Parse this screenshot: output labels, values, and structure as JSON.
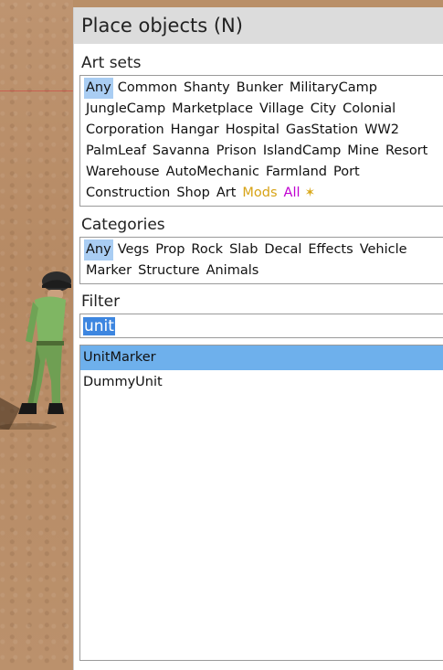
{
  "panel": {
    "title": "Place objects (N)"
  },
  "art_sets": {
    "label": "Art sets",
    "items": [
      "Any",
      "Common",
      "Shanty",
      "Bunker",
      "MilitaryCamp",
      "JungleCamp",
      "Marketplace",
      "Village",
      "City",
      "Colonial",
      "Corporation",
      "Hangar",
      "Hospital",
      "GasStation",
      "WW2",
      "PalmLeaf",
      "Savanna",
      "Prison",
      "IslandCamp",
      "Mine",
      "Resort",
      "Warehouse",
      "AutoMechanic",
      "Farmland",
      "Port",
      "Construction",
      "Shop",
      "Art",
      "Mods",
      "All"
    ],
    "selected": "Any",
    "mods_color": "#d7a316",
    "all_color": "#c000d0",
    "star_icon": "star-icon"
  },
  "categories": {
    "label": "Categories",
    "items": [
      "Any",
      "Vegs",
      "Prop",
      "Rock",
      "Slab",
      "Decal",
      "Effects",
      "Vehicle",
      "Marker",
      "Structure",
      "Animals"
    ],
    "selected": "Any"
  },
  "filter": {
    "label": "Filter",
    "value": "unit"
  },
  "results": {
    "items": [
      "UnitMarker",
      "DummyUnit"
    ],
    "selected": "UnitMarker"
  },
  "colors": {
    "selection": "#6eb0ec",
    "text_highlight": "#3d86e0",
    "title_bar": "#dcdcdc"
  }
}
